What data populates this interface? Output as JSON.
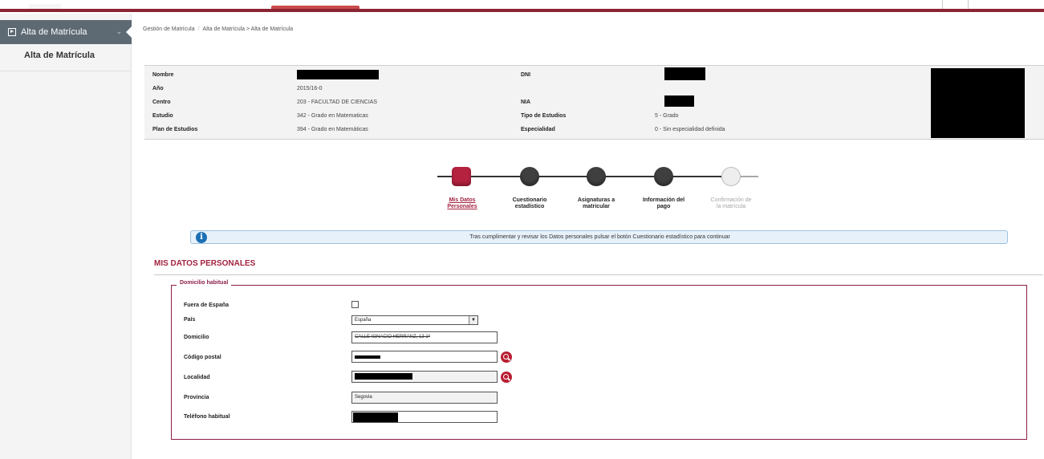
{
  "sidebar": {
    "menu_label": "Alta de Matrícula",
    "submenu_label": "Alta de Matrícula"
  },
  "breadcrumb": {
    "root": "Gestión de Matrícula",
    "path": "Alta de Matrícula > Alta de Matrícula"
  },
  "student": {
    "nombre_label": "Nombre",
    "ano_label": "Año",
    "ano_value": "2015/16-0",
    "centro_label": "Centro",
    "centro_value": "203 - FACULTAD DE CIENCIAS",
    "estudio_label": "Estudio",
    "estudio_value": "342 - Grado en Matematicas",
    "plan_label": "Plan de Estudios",
    "plan_value": "394 - Grado en Matemáticas",
    "dni_label": "DNI",
    "nia_label": "NIA",
    "tipo_label": "Tipo de Estudios",
    "tipo_value": "5 - Grado",
    "especialidad_label": "Especialidad",
    "especialidad_value": "0 - Sin especialidad definida"
  },
  "steps": [
    {
      "line1": "Mis Datos",
      "line2": "Personales",
      "state": "active"
    },
    {
      "line1": "Cuestionario",
      "line2": "estadístico",
      "state": "done"
    },
    {
      "line1": "Asignaturas a",
      "line2": "matricular",
      "state": "done"
    },
    {
      "line1": "Información del",
      "line2": "pago",
      "state": "done"
    },
    {
      "line1": "Confirmación de",
      "line2": "la matrícula",
      "state": "disabled"
    }
  ],
  "message": "Tras cumplimentar y revisar los Datos personales pulsar el botón Cuestionario estadístico para continuar",
  "section_title": "MIS DATOS PERSONALES",
  "fieldset_legend": "Domicilio habitual",
  "form": {
    "fuera_label": "Fuera de España",
    "pais_label": "País",
    "pais_value": "España",
    "domicilio_label": "Domicilio",
    "domicilio_value": "CALLE IGNACIO HERRANZ, 13 1º",
    "cp_label": "Código postal",
    "localidad_label": "Localidad",
    "provincia_label": "Provincia",
    "provincia_value": "Segovia",
    "telefono_label": "Teléfono habitual"
  },
  "colors": {
    "accent": "#a3233f",
    "sidebar_active": "#5e6a73",
    "step_done": "#3f3f3f",
    "info_bg": "#e7f1fa"
  }
}
